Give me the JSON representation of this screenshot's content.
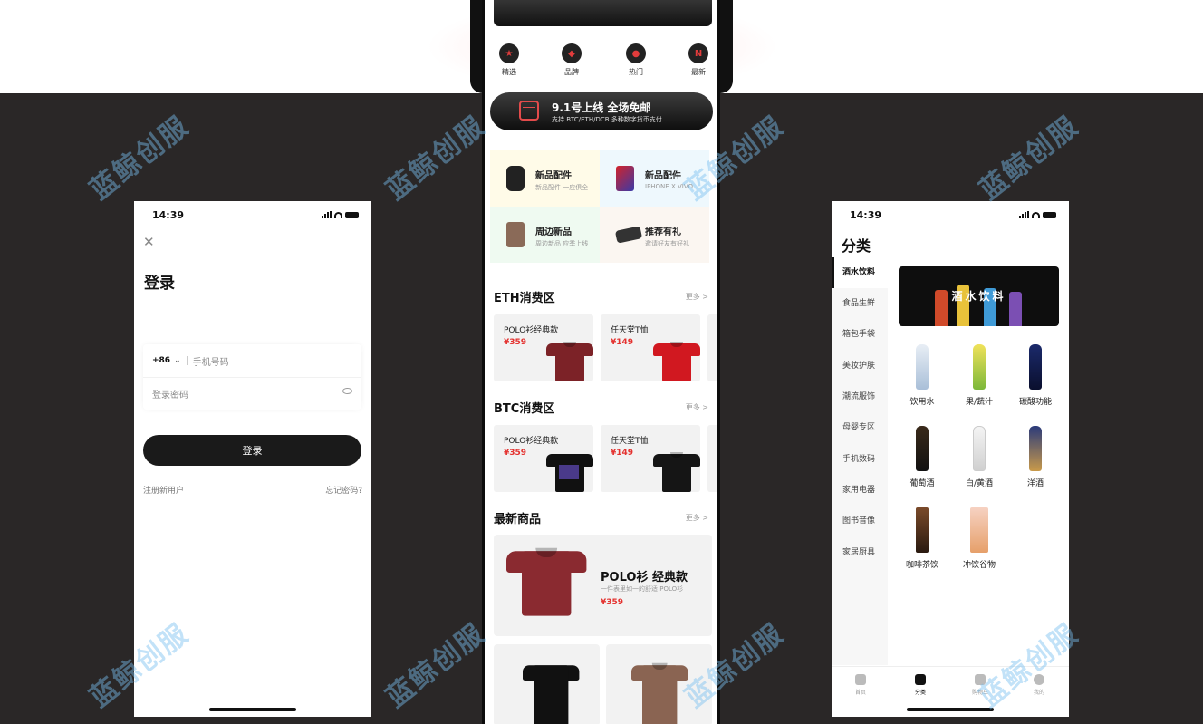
{
  "colors": {
    "accent_red": "#e4322f",
    "dark": "#1a1a1a",
    "background": "#2a2727",
    "watermark": "#78bef0"
  },
  "watermark": "蓝鲸创服",
  "login": {
    "time": "14:39",
    "title": "登录",
    "country_code": "+86",
    "phone_placeholder": "手机号码",
    "password_placeholder": "登录密码",
    "submit": "登录",
    "register": "注册新用户",
    "forgot": "忘记密码?"
  },
  "home": {
    "quick_links": [
      {
        "label": "精选",
        "icon": "star-icon",
        "glyph": "★"
      },
      {
        "label": "品牌",
        "icon": "tag-icon",
        "glyph": "◆"
      },
      {
        "label": "热门",
        "icon": "fire-icon",
        "glyph": "●"
      },
      {
        "label": "最新",
        "icon": "new-icon",
        "glyph": "N"
      }
    ],
    "banner": {
      "title": "9.1号上线 全场免邮",
      "subtitle": "支持 BTC/ETH/DCB 多种数字货币支付"
    },
    "features": [
      {
        "title": "新品配件",
        "subtitle": "新品配件 一应俱全"
      },
      {
        "title": "新品配件",
        "subtitle": "IPHONE X VIVO"
      },
      {
        "title": "周边新品",
        "subtitle": "周边新品 应季上线"
      },
      {
        "title": "推荐有礼",
        "subtitle": "邀请好友有好礼"
      }
    ],
    "sections": [
      {
        "title": "ETH消费区",
        "more": "更多 >",
        "products": [
          {
            "name": "POLO衫经典款",
            "price": "¥359"
          },
          {
            "name": "任天堂T恤",
            "price": "¥149"
          }
        ]
      },
      {
        "title": "BTC消费区",
        "more": "更多 >",
        "products": [
          {
            "name": "POLO衫经典款",
            "price": "¥359"
          },
          {
            "name": "任天堂T恤",
            "price": "¥149"
          }
        ]
      }
    ],
    "latest": {
      "title": "最新商品",
      "more": "更多 >",
      "name": "POLO衫 经典款",
      "desc": "一件表里如一的舒适 POLO衫",
      "price": "¥359"
    }
  },
  "category": {
    "time": "14:39",
    "title": "分类",
    "sidebar": [
      "酒水饮料",
      "食品生鲜",
      "箱包手袋",
      "美妆护肤",
      "潮流服饰",
      "母婴专区",
      "手机数码",
      "家用电器",
      "图书音像",
      "家居厨具"
    ],
    "banner_text": "酒水饮料",
    "items": [
      "饮用水",
      "果/蔬汁",
      "碳酸功能",
      "葡萄酒",
      "白/黄酒",
      "洋酒",
      "咖啡茶饮",
      "冲饮谷物"
    ],
    "tabs": [
      "首页",
      "分类",
      "购物车",
      "我的"
    ]
  }
}
